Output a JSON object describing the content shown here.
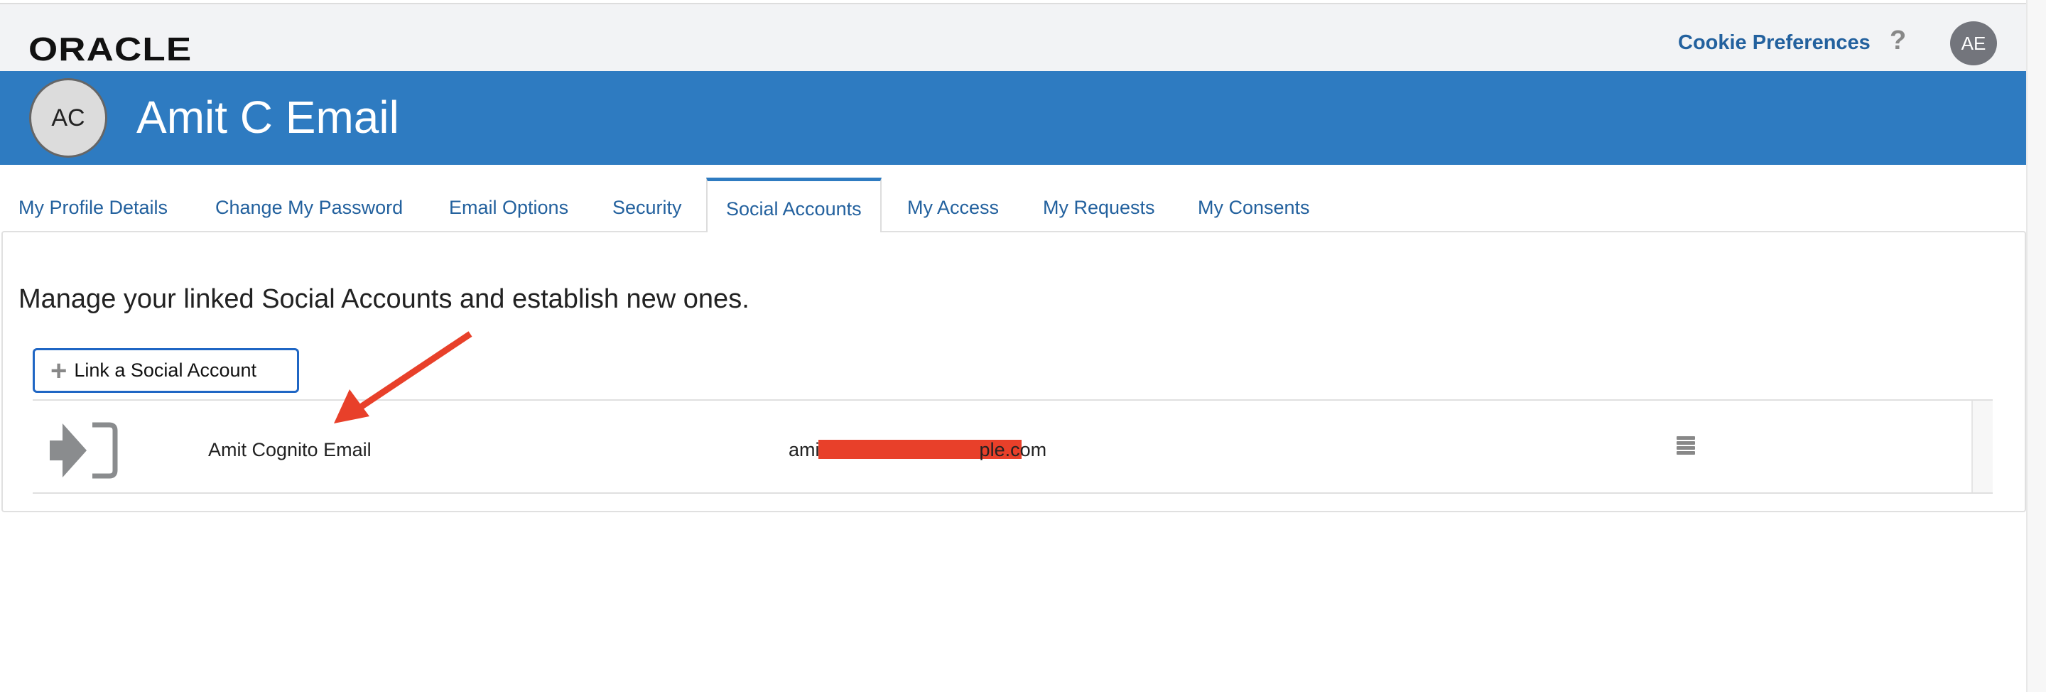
{
  "header": {
    "logo": "ORACLE",
    "cookie_preferences": "Cookie Preferences",
    "help": "?",
    "user_initials": "AE"
  },
  "profile": {
    "initials": "AC",
    "name": "Amit C Email"
  },
  "tabs": [
    {
      "label": "My Profile Details"
    },
    {
      "label": "Change My Password"
    },
    {
      "label": "Email Options"
    },
    {
      "label": "Security"
    },
    {
      "label": "Social Accounts",
      "active": true
    },
    {
      "label": "My Access"
    },
    {
      "label": "My Requests"
    },
    {
      "label": "My Consents"
    }
  ],
  "main": {
    "heading": "Manage your linked Social Accounts and establish new ones.",
    "link_button": "Link a Social Account",
    "accounts": [
      {
        "name": "Amit Cognito Email",
        "email": "ami                              ple.com"
      }
    ]
  },
  "colors": {
    "brand_blue": "#2e7bc1",
    "link": "#23619e",
    "annotation": "#e8402a"
  }
}
